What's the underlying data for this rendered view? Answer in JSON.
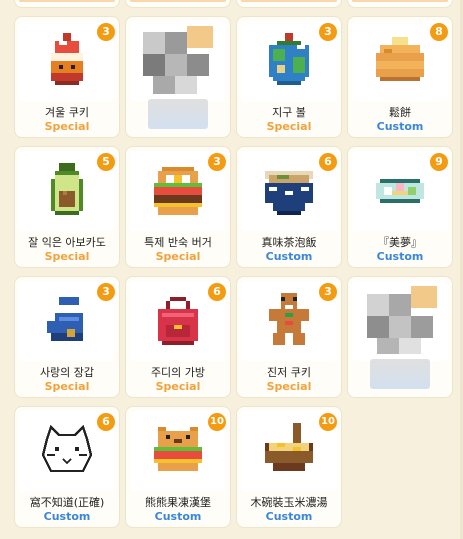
{
  "items": [
    {
      "name": "",
      "tag": "",
      "tag_class": "special",
      "count": "",
      "icon": "stub"
    },
    {
      "name": "",
      "tag": "",
      "tag_class": "special",
      "count": "",
      "icon": "stub"
    },
    {
      "name": "",
      "tag": "",
      "tag_class": "special",
      "count": "",
      "icon": "stub"
    },
    {
      "name": "",
      "tag": "",
      "tag_class": "special",
      "count": "",
      "icon": "stub"
    },
    {
      "name": "겨울 쿠키",
      "tag": "Special",
      "tag_class": "special",
      "count": "3",
      "icon": "winter-cookie-icon"
    },
    {
      "name": "",
      "tag": "",
      "tag_class": "custom",
      "count": "",
      "icon": "blurred-image"
    },
    {
      "name": "지구 볼",
      "tag": "Special",
      "tag_class": "special",
      "count": "3",
      "icon": "earth-ball-icon"
    },
    {
      "name": "鬆餅",
      "tag": "Custom",
      "tag_class": "custom",
      "count": "8",
      "icon": "pancake-icon"
    },
    {
      "name": "잘 익은 아보카도",
      "tag": "Special",
      "tag_class": "special",
      "count": "5",
      "icon": "avocado-icon"
    },
    {
      "name": "특제 반숙 버거",
      "tag": "Special",
      "tag_class": "special",
      "count": "3",
      "icon": "burger-icon"
    },
    {
      "name": "真味茶泡飯",
      "tag": "Custom",
      "tag_class": "custom",
      "count": "6",
      "icon": "rice-bowl-icon"
    },
    {
      "name": "『美夢』",
      "tag": "Custom",
      "tag_class": "custom",
      "count": "9",
      "icon": "dream-plate-icon"
    },
    {
      "name": "사랑의 장갑",
      "tag": "Special",
      "tag_class": "special",
      "count": "3",
      "icon": "mitten-icon"
    },
    {
      "name": "주디의 가방",
      "tag": "Special",
      "tag_class": "special",
      "count": "6",
      "icon": "backpack-icon"
    },
    {
      "name": "진저 쿠키",
      "tag": "Special",
      "tag_class": "special",
      "count": "3",
      "icon": "gingerbread-icon"
    },
    {
      "name": "",
      "tag": "",
      "tag_class": "custom",
      "count": "",
      "icon": "blurred-image"
    },
    {
      "name": "窩不知道(正確)",
      "tag": "Custom",
      "tag_class": "custom",
      "count": "6",
      "icon": "sketch-cat-icon"
    },
    {
      "name": "熊熊果凍漢堡",
      "tag": "Custom",
      "tag_class": "custom",
      "count": "10",
      "icon": "bear-burger-icon"
    },
    {
      "name": "木碗裝玉米濃湯",
      "tag": "Custom",
      "tag_class": "custom",
      "count": "10",
      "icon": "corn-soup-icon"
    }
  ]
}
